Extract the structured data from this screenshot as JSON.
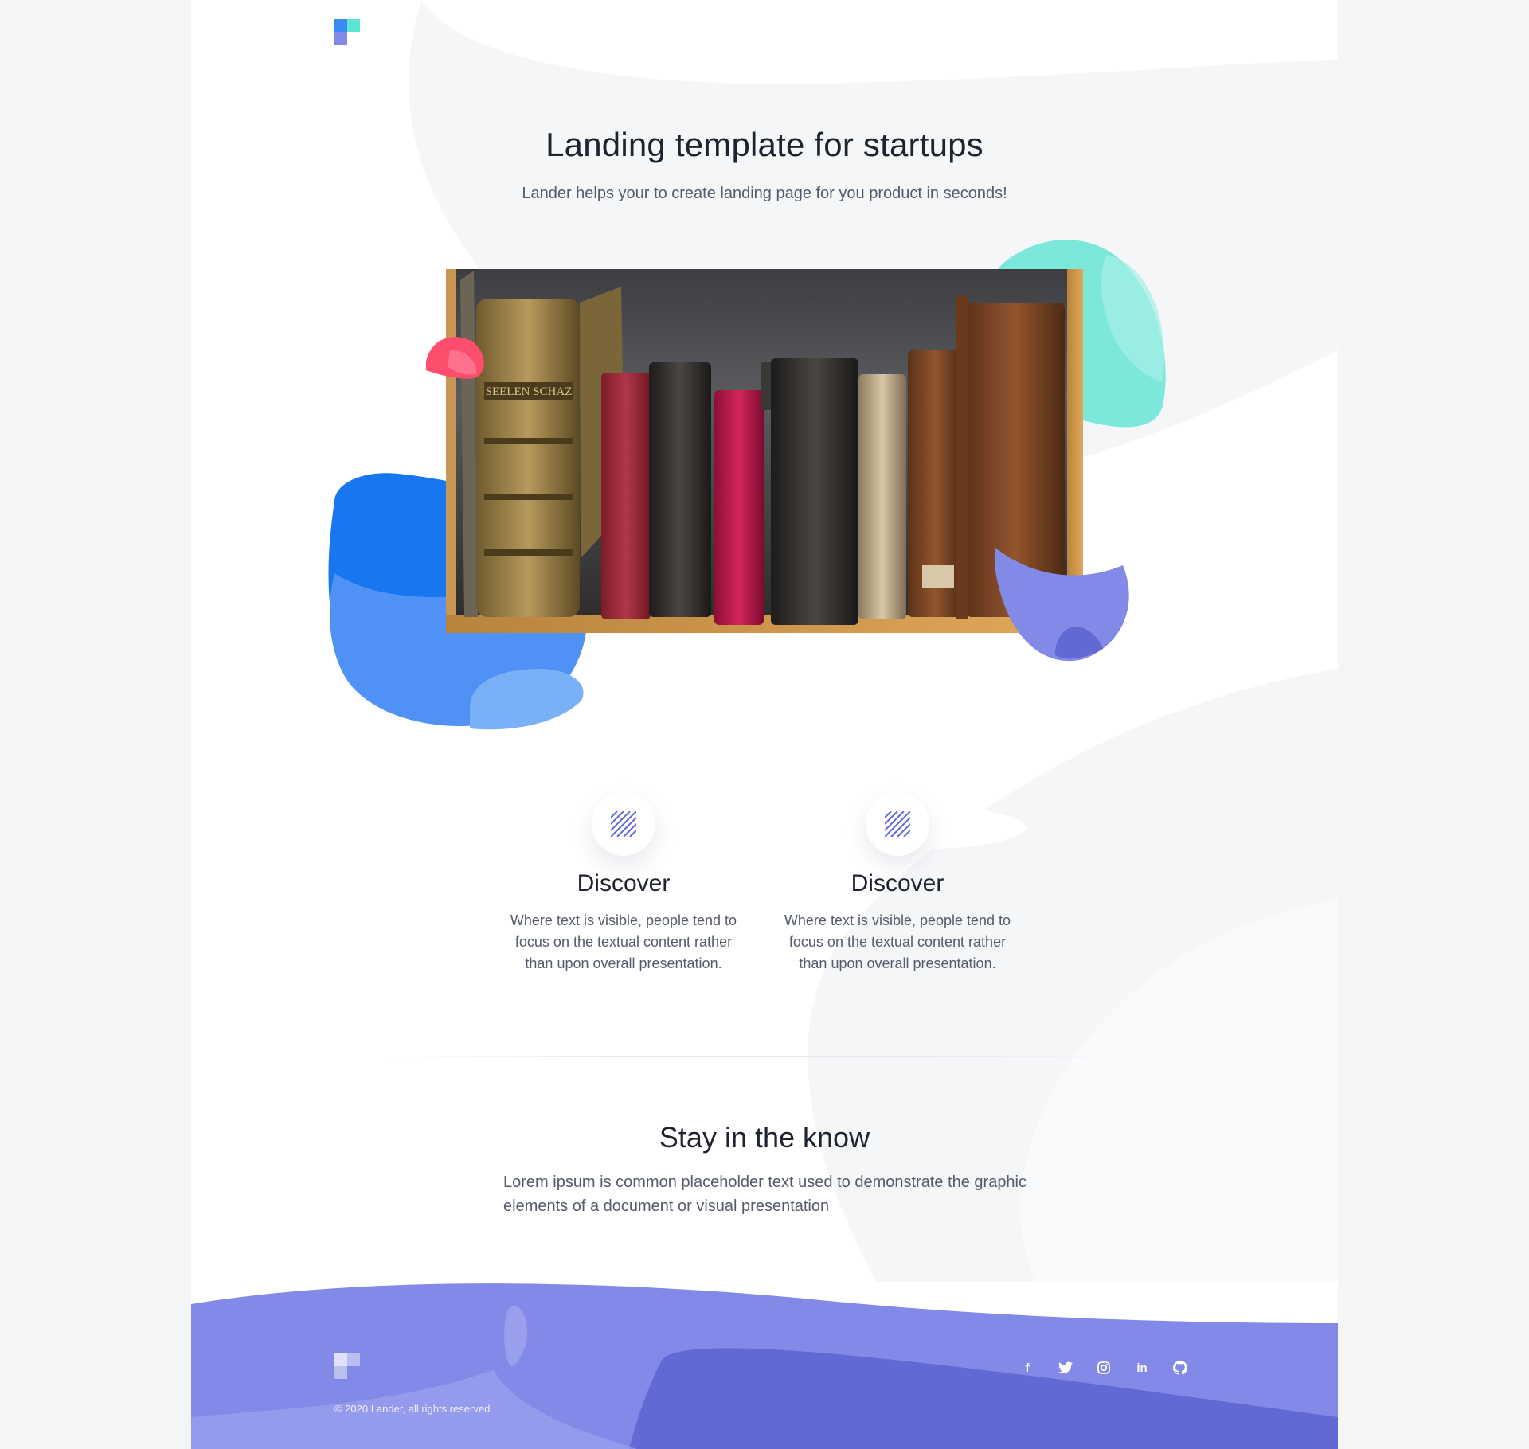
{
  "hero": {
    "title": "Landing template for startups",
    "subtitle": "Lander helps your to create landing page for you product in seconds!"
  },
  "features": [
    {
      "icon": "hatched-square-icon",
      "title": "Discover",
      "text": "Where text is visible, people tend to focus on the textual content rather than upon overall presentation."
    },
    {
      "icon": "hatched-square-icon",
      "title": "Discover",
      "text": "Where text is visible, people tend to focus on the textual content rather than upon overall presentation."
    }
  ],
  "cta": {
    "title": "Stay in the know",
    "text": "Lorem ipsum is common placeholder text used to demonstrate the graphic elements of a document or visual presentation"
  },
  "footer": {
    "copyright": "© 2020 Lander, all rights reserved",
    "socials": [
      {
        "icon": "facebook-icon",
        "glyph": "f"
      },
      {
        "icon": "twitter-icon",
        "glyph": "🐦"
      },
      {
        "icon": "instagram-icon",
        "glyph": "◎"
      },
      {
        "icon": "linkedin-icon",
        "glyph": "in"
      },
      {
        "icon": "github-icon",
        "glyph": "◉"
      }
    ]
  },
  "colors": {
    "accent_blue": "#1877ee",
    "accent_teal": "#5ce5d2",
    "accent_pink": "#ff4d6d",
    "accent_purple": "#8289e6",
    "footer_purple": "#6369d4"
  }
}
